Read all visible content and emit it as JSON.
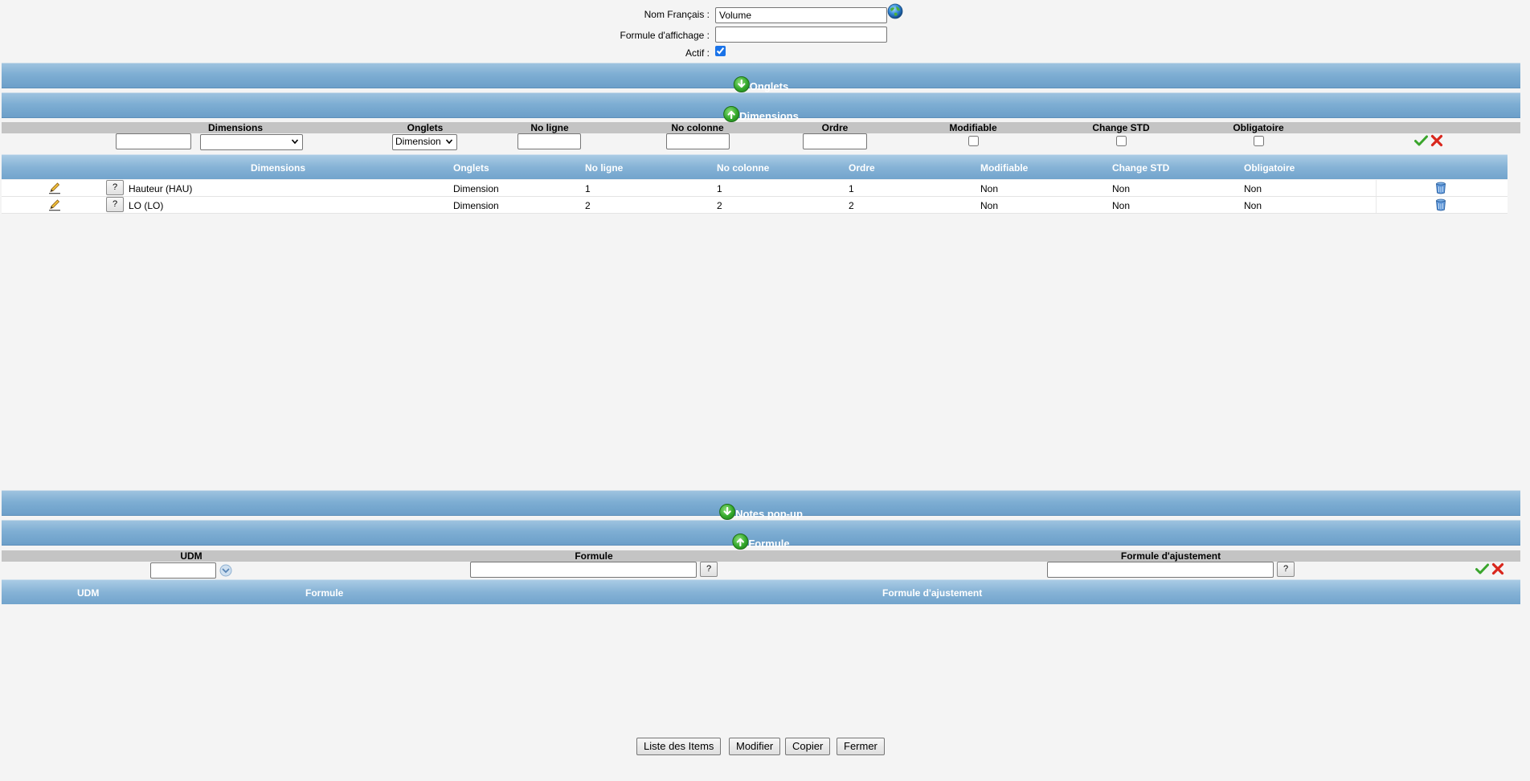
{
  "form": {
    "nom_label": "Nom Français :",
    "nom_value": "Volume",
    "formule_label": "Formule d'affichage :",
    "formule_value": "",
    "actif_label": "Actif :",
    "actif_checked": true
  },
  "sections": {
    "onglets": "Onglets",
    "dimensions": "Dimensions",
    "notes": "Notes pop-up",
    "formule": "Formule"
  },
  "dimensions_edit": {
    "headers": [
      "Dimensions",
      "Onglets",
      "No ligne",
      "No colonne",
      "Ordre",
      "Modifiable",
      "Change STD",
      "Obligatoire"
    ],
    "onglet_select_value": "Dimension"
  },
  "dimensions_table": {
    "headers": [
      "Dimensions",
      "Onglets",
      "No ligne",
      "No colonne",
      "Ordre",
      "Modifiable",
      "Change STD",
      "Obligatoire"
    ],
    "rows": [
      {
        "dimension": "Hauteur (HAU)",
        "onglet": "Dimension",
        "ligne": "1",
        "colonne": "1",
        "ordre": "1",
        "modifiable": "Non",
        "change_std": "Non",
        "obligatoire": "Non"
      },
      {
        "dimension": "LO (LO)",
        "onglet": "Dimension",
        "ligne": "2",
        "colonne": "2",
        "ordre": "2",
        "modifiable": "Non",
        "change_std": "Non",
        "obligatoire": "Non"
      }
    ]
  },
  "formule_edit": {
    "headers": [
      "UDM",
      "Formule",
      "Formule d'ajustement"
    ]
  },
  "formule_table": {
    "headers": [
      "UDM",
      "Formule",
      "Formule d'ajustement"
    ]
  },
  "help_label": "?",
  "buttons": {
    "liste": "Liste des Items",
    "modifier": "Modifier",
    "copier": "Copier",
    "fermer": "Fermer"
  },
  "icons": {
    "expand": "arrow-down-circle-icon",
    "collapse": "arrow-up-circle-icon",
    "globe": "globe-icon",
    "edit": "pencil-icon",
    "delete": "trash-icon",
    "ok": "checkmark-icon",
    "cancel": "red-x-icon"
  }
}
